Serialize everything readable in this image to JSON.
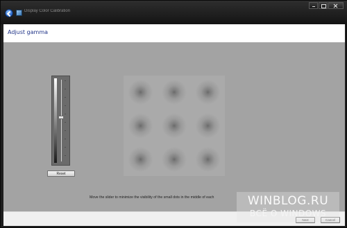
{
  "window": {
    "title": "Display Color Calibration"
  },
  "header": {
    "title": "Adjust gamma"
  },
  "gamma_slider": {
    "level_fraction": 0.54,
    "reset_label": "Reset"
  },
  "dots_grid": {
    "count": 9
  },
  "instruction": "Move the slider to minimize the visibility of the small dots in the middle of each",
  "footer": {
    "next_label": "Next",
    "cancel_label": "Cancel"
  },
  "watermark": {
    "title": "WINBLOG.RU",
    "subtitle": "ВСЁ О WINDOWS"
  },
  "colors": {
    "content_background": "#a3a3a3",
    "heading_color": "#1e3287",
    "titlebar": "#1c1c1c"
  }
}
